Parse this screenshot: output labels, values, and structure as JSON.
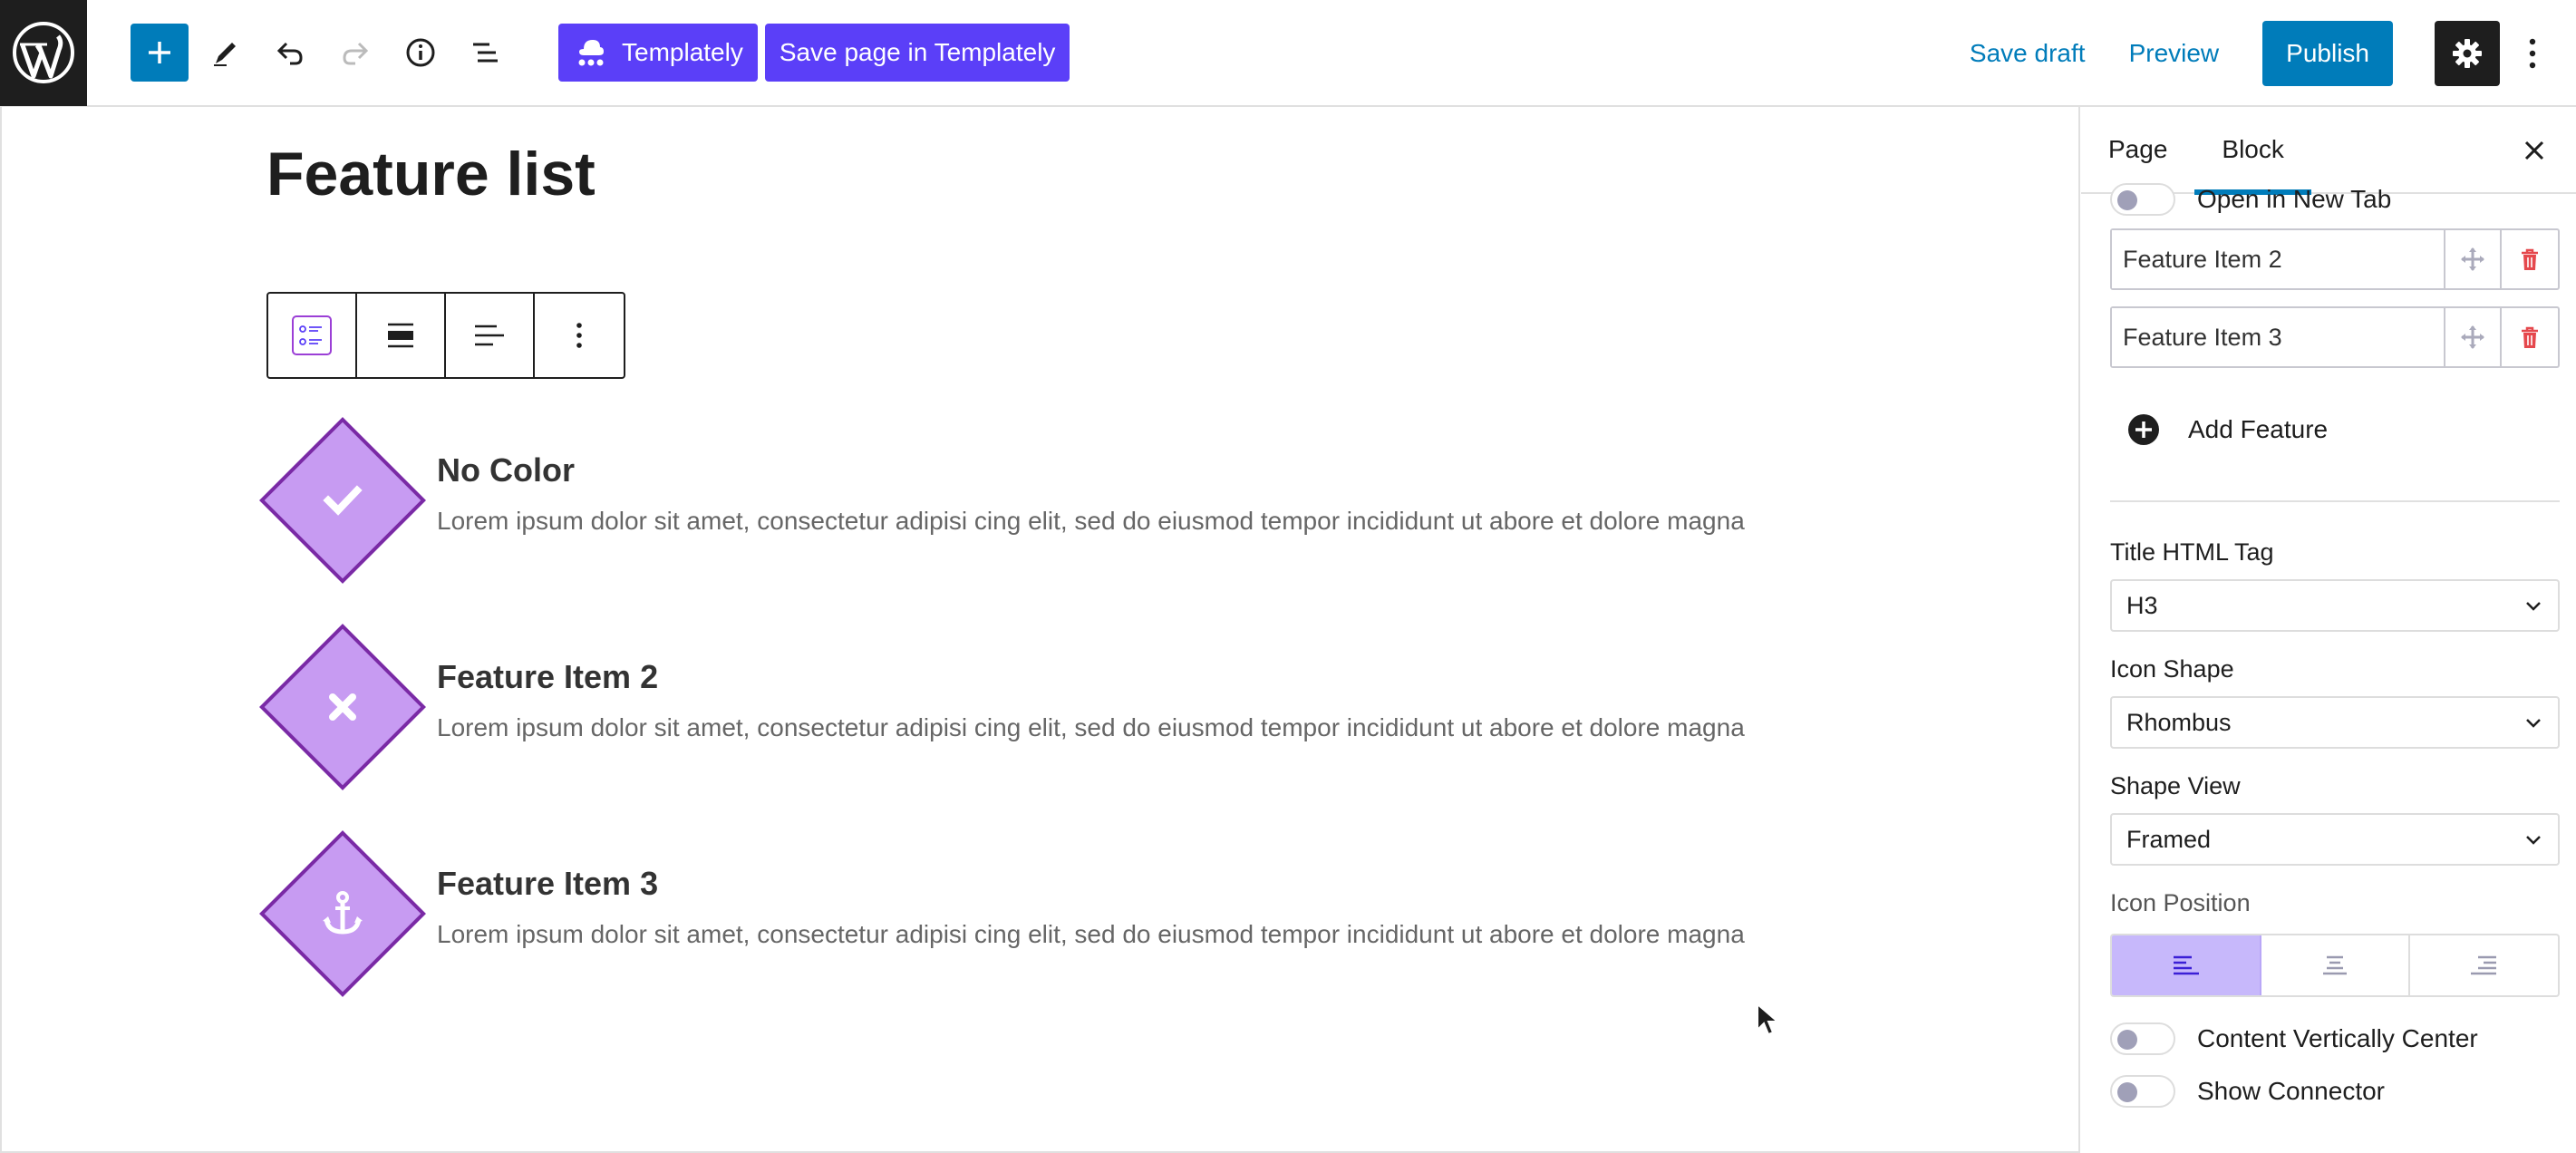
{
  "toolbar": {
    "templately_label": "Templately",
    "save_templately_label": "Save page in Templately",
    "save_draft": "Save draft",
    "preview": "Preview",
    "publish": "Publish"
  },
  "editor": {
    "page_title": "Feature list",
    "features": [
      {
        "title": "No Color",
        "icon": "check-icon",
        "desc": "Lorem ipsum dolor sit amet, consectetur adipisi cing elit, sed do eiusmod tempor incididunt ut abore et dolore magna"
      },
      {
        "title": "Feature Item 2",
        "icon": "times-icon",
        "desc": "Lorem ipsum dolor sit amet, consectetur adipisi cing elit, sed do eiusmod tempor incididunt ut abore et dolore magna"
      },
      {
        "title": "Feature Item 3",
        "icon": "anchor-icon",
        "desc": "Lorem ipsum dolor sit amet, consectetur adipisi cing elit, sed do eiusmod tempor incididunt ut abore et dolore magna"
      }
    ]
  },
  "sidebar": {
    "tabs": [
      "Page",
      "Block"
    ],
    "open_new_tab": "Open in New Tab",
    "repeater_items": [
      "Feature Item 2",
      "Feature Item 3"
    ],
    "add_feature": "Add Feature",
    "title_tag_label": "Title HTML Tag",
    "title_tag_value": "H3",
    "icon_shape_label": "Icon Shape",
    "icon_shape_value": "Rhombus",
    "shape_view_label": "Shape View",
    "shape_view_value": "Framed",
    "icon_position_label": "Icon Position",
    "content_vertical_center": "Content Vertically Center",
    "show_connector": "Show Connector"
  },
  "colors": {
    "wp_blue": "#007cba",
    "templately_purple": "#5b3ff8",
    "rhombus_fill": "#c79bf2",
    "rhombus_border": "#7a2aa5"
  }
}
